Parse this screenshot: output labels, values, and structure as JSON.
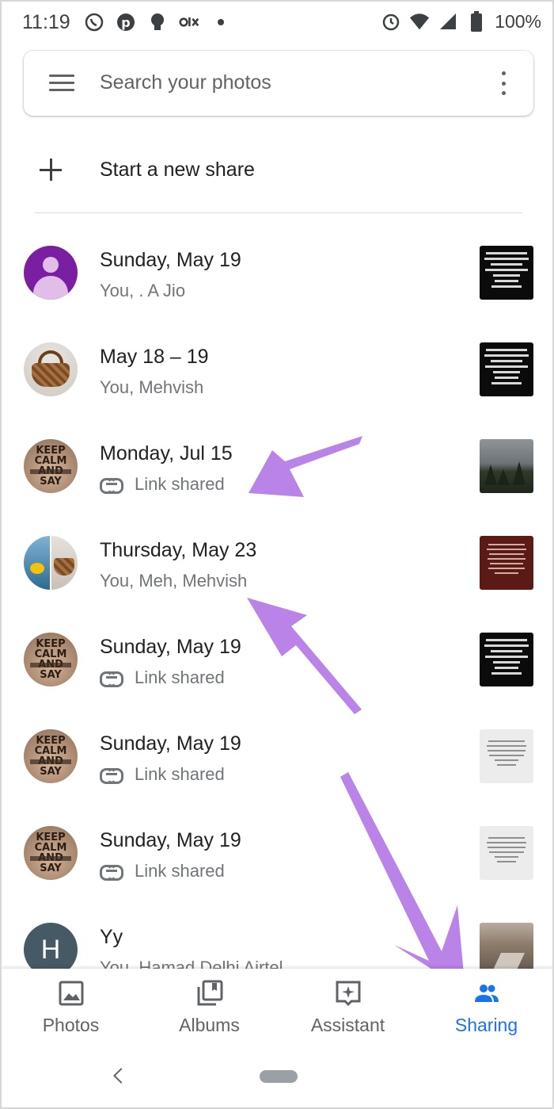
{
  "status_bar": {
    "time": "11:19",
    "battery": "100%"
  },
  "search": {
    "placeholder": "Search your photos"
  },
  "new_share": {
    "label": "Start a new share"
  },
  "shares": [
    {
      "title": "Sunday, May 19",
      "subtitle": "You, . A Jio",
      "link_shared": false
    },
    {
      "title": "May 18 – 19",
      "subtitle": "You, Mehvish",
      "link_shared": false
    },
    {
      "title": "Monday, Jul 15",
      "subtitle": "Link shared",
      "link_shared": true
    },
    {
      "title": "Thursday, May 23",
      "subtitle": "You, Meh, Mehvish",
      "link_shared": false
    },
    {
      "title": "Sunday, May 19",
      "subtitle": "Link shared",
      "link_shared": true
    },
    {
      "title": "Sunday, May 19",
      "subtitle": "Link shared",
      "link_shared": true
    },
    {
      "title": "Sunday, May 19",
      "subtitle": "Link shared",
      "link_shared": true
    },
    {
      "title": "Yy",
      "subtitle": "You, Hamad Delhi Airtel",
      "link_shared": false,
      "avatar_letter": "H"
    }
  ],
  "nav": {
    "photos": "Photos",
    "albums": "Albums",
    "assistant": "Assistant",
    "sharing": "Sharing",
    "active": "sharing"
  },
  "colors": {
    "accent": "#1a73e8",
    "annotation_arrow": "#b983e8"
  }
}
